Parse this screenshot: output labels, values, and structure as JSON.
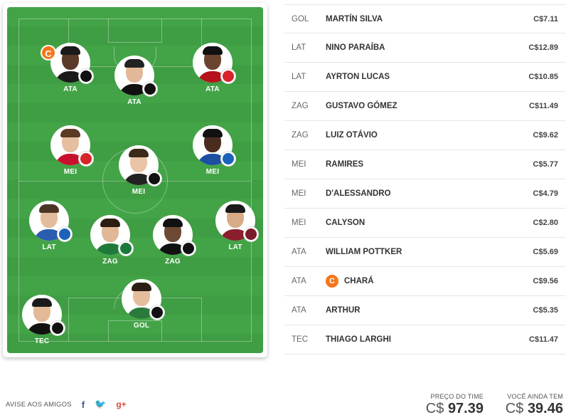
{
  "field": {
    "players": [
      {
        "pos": "ATA",
        "captain": true,
        "shirt": "#1a1a1a",
        "skin": "#5a3a28",
        "hair": "#1a1a1a",
        "club": "atletico-mg-shield-icon",
        "club_color": "#111111",
        "club_mark": ""
      },
      {
        "pos": "ATA",
        "captain": false,
        "shirt": "#111111",
        "skin": "#e2b899",
        "hair": "#222222",
        "club": "ceara-shield-icon",
        "club_color": "#111111",
        "club_mark": ""
      },
      {
        "pos": "ATA",
        "captain": false,
        "shirt": "#b5121b",
        "skin": "#6b4430",
        "hair": "#111111",
        "club": "internacional-shield-icon",
        "club_color": "#d8232a",
        "club_mark": ""
      },
      {
        "pos": "MEI",
        "captain": false,
        "shirt": "#c8102e",
        "skin": "#e6bfa0",
        "hair": "#5a3b24",
        "club": "internacional-shield-icon",
        "club_color": "#d8232a",
        "club_mark": ""
      },
      {
        "pos": "MEI",
        "captain": false,
        "shirt": "#222222",
        "skin": "#e9c4a6",
        "hair": "#3a2a1a",
        "club": "ceara-shield-icon",
        "club_color": "#111111",
        "club_mark": ""
      },
      {
        "pos": "MEI",
        "captain": false,
        "shirt": "#1c4fa0",
        "skin": "#4a2d1e",
        "hair": "#111111",
        "club": "bahia-shield-icon",
        "club_color": "#1c62b9",
        "club_mark": ""
      },
      {
        "pos": "LAT",
        "captain": false,
        "shirt": "#2a5db0",
        "skin": "#e3bc9c",
        "hair": "#4a3524",
        "club": "bahia-shield-icon",
        "club_color": "#1c62b9",
        "club_mark": ""
      },
      {
        "pos": "ZAG",
        "captain": false,
        "shirt": "#1f7a3a",
        "skin": "#e0b897",
        "hair": "#2b1d12",
        "club": "palmeiras-shield-icon",
        "club_color": "#1a7a3c",
        "club_mark": ""
      },
      {
        "pos": "ZAG",
        "captain": false,
        "shirt": "#111111",
        "skin": "#6e4a35",
        "hair": "#111111",
        "club": "ceara-shield-icon",
        "club_color": "#111111",
        "club_mark": ""
      },
      {
        "pos": "LAT",
        "captain": false,
        "shirt": "#8b1e2d",
        "skin": "#d9aa86",
        "hair": "#1a1a1a",
        "club": "fluminense-shield-icon",
        "club_color": "#7a1a2b",
        "club_mark": ""
      },
      {
        "pos": "GOL",
        "captain": false,
        "shirt": "#2a7a3c",
        "skin": "#e4bd9d",
        "hair": "#2a1e14",
        "club": "vasco-shield-icon",
        "club_color": "#111111",
        "club_mark": ""
      },
      {
        "pos": "TEC",
        "captain": false,
        "shirt": "#111111",
        "skin": "#e2ba98",
        "hair": "#1a1a1a",
        "club": "atletico-mg-shield-icon",
        "club_color": "#111111",
        "club_mark": ""
      }
    ]
  },
  "list": [
    {
      "pos": "GOL",
      "name": "MARTÍN SILVA",
      "price": "C$7.11",
      "captain": false
    },
    {
      "pos": "LAT",
      "name": "NINO PARAÍBA",
      "price": "C$12.89",
      "captain": false
    },
    {
      "pos": "LAT",
      "name": "AYRTON LUCAS",
      "price": "C$10.85",
      "captain": false
    },
    {
      "pos": "ZAG",
      "name": "GUSTAVO GÓMEZ",
      "price": "C$11.49",
      "captain": false
    },
    {
      "pos": "ZAG",
      "name": "LUIZ OTÁVIO",
      "price": "C$9.62",
      "captain": false
    },
    {
      "pos": "MEI",
      "name": "RAMIRES",
      "price": "C$5.77",
      "captain": false
    },
    {
      "pos": "MEI",
      "name": "D'ALESSANDRO",
      "price": "C$4.79",
      "captain": false
    },
    {
      "pos": "MEI",
      "name": "CALYSON",
      "price": "C$2.80",
      "captain": false
    },
    {
      "pos": "ATA",
      "name": "WILLIAM POTTKER",
      "price": "C$5.69",
      "captain": false
    },
    {
      "pos": "ATA",
      "name": "CHARÁ",
      "price": "C$9.56",
      "captain": true
    },
    {
      "pos": "ATA",
      "name": "ARTHUR",
      "price": "C$5.35",
      "captain": false
    },
    {
      "pos": "TEC",
      "name": "THIAGO LARGHI",
      "price": "C$11.47",
      "captain": false
    }
  ],
  "captain_letter": "C",
  "share": {
    "label": "AVISE AOS AMIGOS",
    "facebook_icon": "f",
    "twitter_icon": "🐦",
    "gplus_icon": "g+"
  },
  "team_price": {
    "label": "PREÇO DO TIME",
    "currency": "C$",
    "value": "97.39"
  },
  "remaining": {
    "label": "VOCÊ AINDA TEM",
    "currency": "C$",
    "value": "39.46"
  }
}
